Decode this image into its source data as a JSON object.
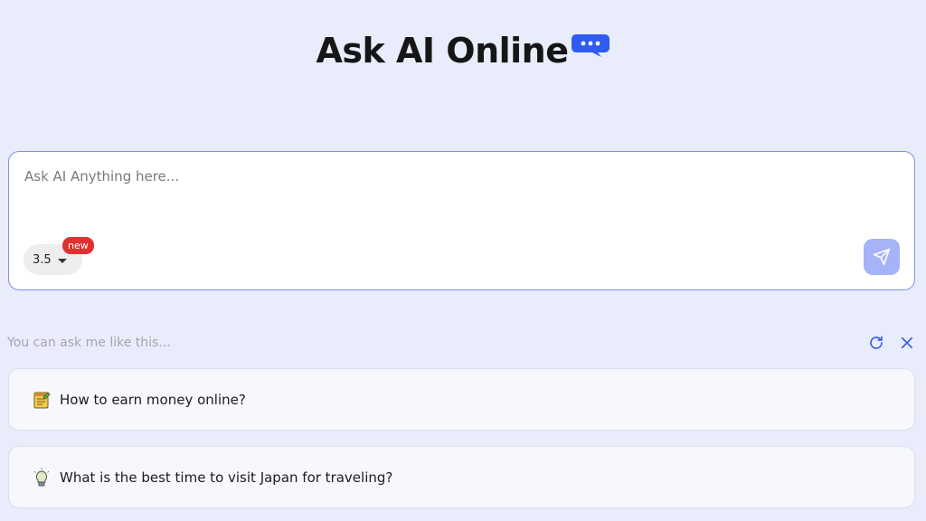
{
  "header": {
    "title": "Ask AI Online",
    "icon": "chat-bubble-icon",
    "accent_color": "#2f5bf0"
  },
  "prompt": {
    "placeholder": "Ask AI Anything here...",
    "value": "",
    "model": "3.5",
    "badge": "new",
    "badge_color": "#e03131",
    "send_icon": "send-icon",
    "border_color": "#7e8ff0"
  },
  "suggestions": {
    "label": "You can ask me like this...",
    "refresh_icon": "refresh-icon",
    "close_icon": "close-icon",
    "items": [
      {
        "icon": "notepad-icon",
        "text": "How to earn money online?"
      },
      {
        "icon": "lightbulb-icon",
        "text": "What is the best time to visit Japan for traveling?"
      }
    ]
  }
}
